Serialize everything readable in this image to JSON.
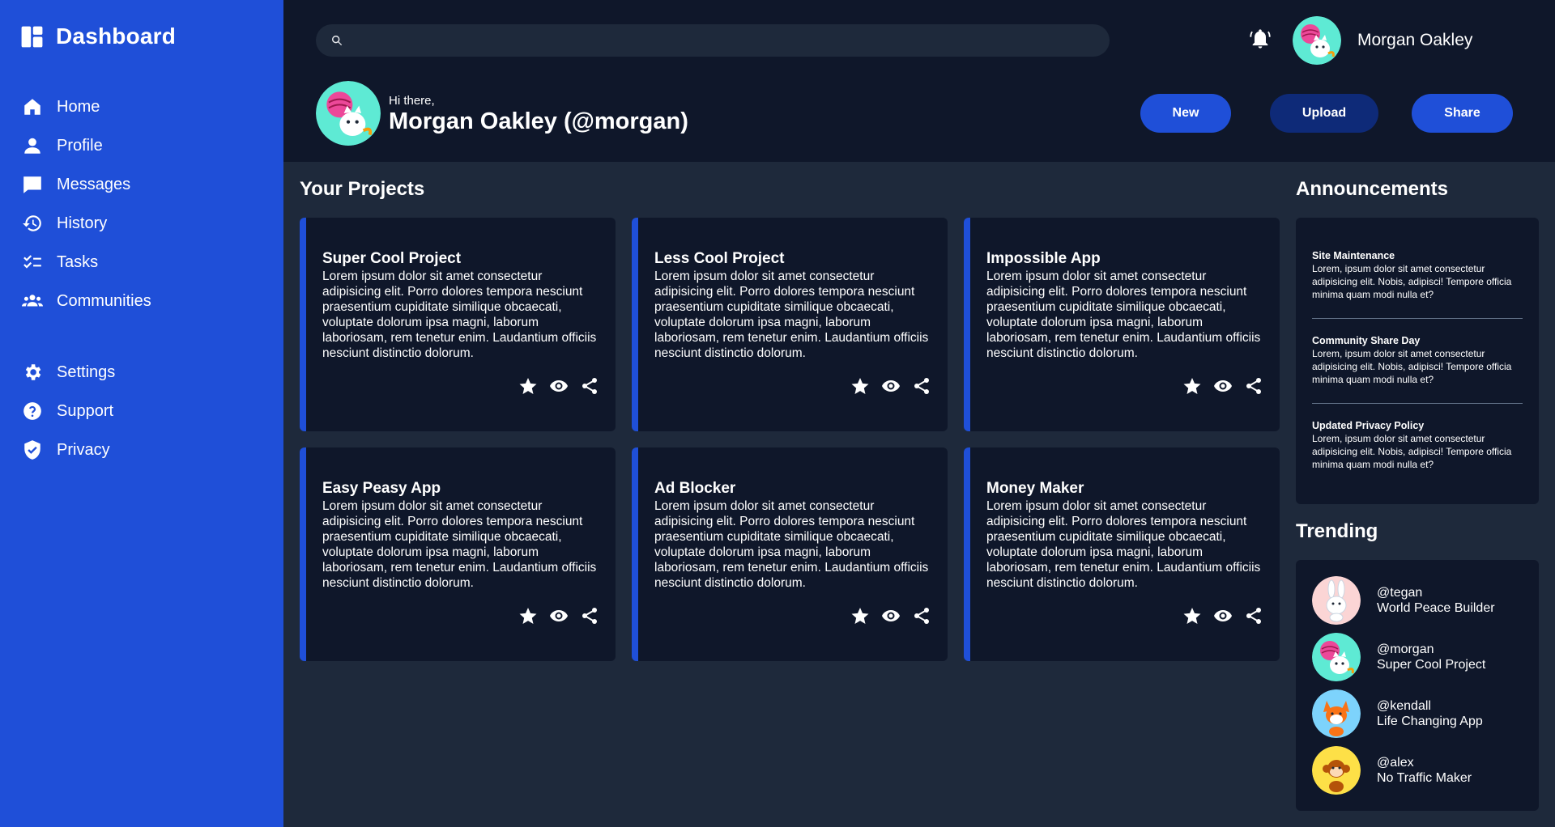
{
  "sidebar": {
    "title": "Dashboard",
    "items": [
      {
        "label": "Home",
        "icon": "home-icon"
      },
      {
        "label": "Profile",
        "icon": "person-icon"
      },
      {
        "label": "Messages",
        "icon": "chat-icon"
      },
      {
        "label": "History",
        "icon": "history-icon"
      },
      {
        "label": "Tasks",
        "icon": "tasks-icon"
      },
      {
        "label": "Communities",
        "icon": "group-icon"
      }
    ],
    "secondary": [
      {
        "label": "Settings",
        "icon": "gear-icon"
      },
      {
        "label": "Support",
        "icon": "help-icon"
      },
      {
        "label": "Privacy",
        "icon": "shield-icon"
      }
    ]
  },
  "header": {
    "search_placeholder": "",
    "user_name": "Morgan Oakley",
    "greeting_small": "Hi there,",
    "greeting_big": "Morgan Oakley (@morgan)",
    "buttons": {
      "new": "New",
      "upload": "Upload",
      "share": "Share"
    }
  },
  "projects": {
    "title": "Your Projects",
    "items": [
      {
        "title": "Super Cool Project",
        "desc": "Lorem ipsum dolor sit amet consectetur adipisicing elit. Porro dolores tempora nesciunt praesentium cupiditate similique obcaecati, voluptate dolorum ipsa magni, laborum laboriosam, rem tenetur enim. Laudantium officiis nesciunt distinctio dolorum."
      },
      {
        "title": "Less Cool Project",
        "desc": "Lorem ipsum dolor sit amet consectetur adipisicing elit. Porro dolores tempora nesciunt praesentium cupiditate similique obcaecati, voluptate dolorum ipsa magni, laborum laboriosam, rem tenetur enim. Laudantium officiis nesciunt distinctio dolorum."
      },
      {
        "title": "Impossible App",
        "desc": "Lorem ipsum dolor sit amet consectetur adipisicing elit. Porro dolores tempora nesciunt praesentium cupiditate similique obcaecati, voluptate dolorum ipsa magni, laborum laboriosam, rem tenetur enim. Laudantium officiis nesciunt distinctio dolorum."
      },
      {
        "title": "Easy Peasy App",
        "desc": "Lorem ipsum dolor sit amet consectetur adipisicing elit. Porro dolores tempora nesciunt praesentium cupiditate similique obcaecati, voluptate dolorum ipsa magni, laborum laboriosam, rem tenetur enim. Laudantium officiis nesciunt distinctio dolorum."
      },
      {
        "title": "Ad Blocker",
        "desc": "Lorem ipsum dolor sit amet consectetur adipisicing elit. Porro dolores tempora nesciunt praesentium cupiditate similique obcaecati, voluptate dolorum ipsa magni, laborum laboriosam, rem tenetur enim. Laudantium officiis nesciunt distinctio dolorum."
      },
      {
        "title": "Money Maker",
        "desc": "Lorem ipsum dolor sit amet consectetur adipisicing elit. Porro dolores tempora nesciunt praesentium cupiditate similique obcaecati, voluptate dolorum ipsa magni, laborum laboriosam, rem tenetur enim. Laudantium officiis nesciunt distinctio dolorum."
      }
    ]
  },
  "announcements": {
    "title": "Announcements",
    "items": [
      {
        "title": "Site Maintenance",
        "desc": "Lorem, ipsum dolor sit amet consectetur adipisicing elit. Nobis, adipisci! Tempore officia minima quam modi nulla et?"
      },
      {
        "title": "Community Share Day",
        "desc": "Lorem, ipsum dolor sit amet consectetur adipisicing elit. Nobis, adipisci! Tempore officia minima quam modi nulla et?"
      },
      {
        "title": "Updated Privacy Policy",
        "desc": "Lorem, ipsum dolor sit amet consectetur adipisicing elit. Nobis, adipisci! Tempore officia minima quam modi nulla et?"
      }
    ]
  },
  "trending": {
    "title": "Trending",
    "items": [
      {
        "handle": "@tegan",
        "project": "World Peace Builder"
      },
      {
        "handle": "@morgan",
        "project": "Super Cool Project"
      },
      {
        "handle": "@kendall",
        "project": "Life Changing App"
      },
      {
        "handle": "@alex",
        "project": "No Traffic Maker"
      }
    ]
  },
  "colors": {
    "sidebar": "#1f4fd8",
    "header": "#0f172a",
    "main": "#1e293b",
    "accent": "#1f4fd8",
    "upload_button": "#0e2a78"
  }
}
